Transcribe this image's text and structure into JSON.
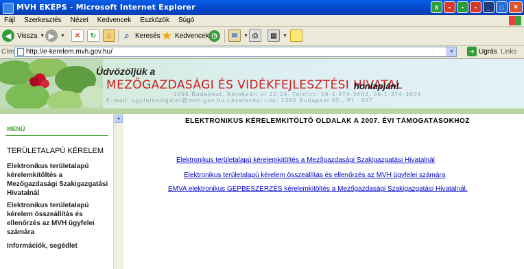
{
  "window": {
    "title": "MVH EKÉPS - Microsoft Internet Explorer"
  },
  "menubar": {
    "items": [
      "Fájl",
      "Szerkesztés",
      "Nézet",
      "Kedvencek",
      "Eszközök",
      "Súgó"
    ]
  },
  "toolbar": {
    "back_label": "Vissza",
    "search_label": "Keresés",
    "favorites_label": "Kedvencek"
  },
  "addressbar": {
    "label": "Cím",
    "url": "http://e-kerelem.mvh.gov.hu/",
    "go_label": "Ugrás",
    "links_label": "Links"
  },
  "banner": {
    "welcome": "Üdvözöljük a",
    "agency": "MEZŐGAZDASÁGI ÉS VIDÉKFEJLESZTÉSI HIVATAL",
    "homepage": "honlapján!",
    "address_line": "1095 Budapest, Soroksári út 22-24. Telefon: 06-1-374-3603, 06-1-374-3604.",
    "contact_line": "E-mail: ugyfelszolgalat@mvh.gov.hu Levelezési cím: 1385 Budapest 62., Pf.: 867."
  },
  "sidebar": {
    "menu_title": "MENÜ",
    "section_title": "TERÜLETALAPÚ KÉRELEM",
    "links": [
      "Elektronikus területalapú kérelemkitöltés a Mezőgazdasági Szakigazgatási Hivatalnál",
      "Elektronikus területalapú kérelem összeállítás és ellenőrzés az MVH ügyfelei számára",
      "Információk, segédlet"
    ]
  },
  "main": {
    "heading": "ELEKTRONIKUS KÉRELEMKITÖLTŐ OLDALAK A 2007. ÉVI TÁMOGATÁSOKHOZ",
    "links": [
      "Elektronikus területalapú kérelemkitöltés a Mezőgazdasági Szakigazgatási Hivatalnál",
      "Elektronikus területalapú kérelem összeállítás és ellenőrzés az MVH ügyfelei számára",
      "EMVA elektronikus GÉPBESZERZÉS kérelemkitöltés a Mezőgazdasági Szakigazgatási Hivatalnál."
    ]
  },
  "colors": {
    "titlebar": "#0A5FE8",
    "agency_red": "#D01A1A",
    "menu_green": "#4AA63A",
    "link_blue": "#0000CC"
  }
}
